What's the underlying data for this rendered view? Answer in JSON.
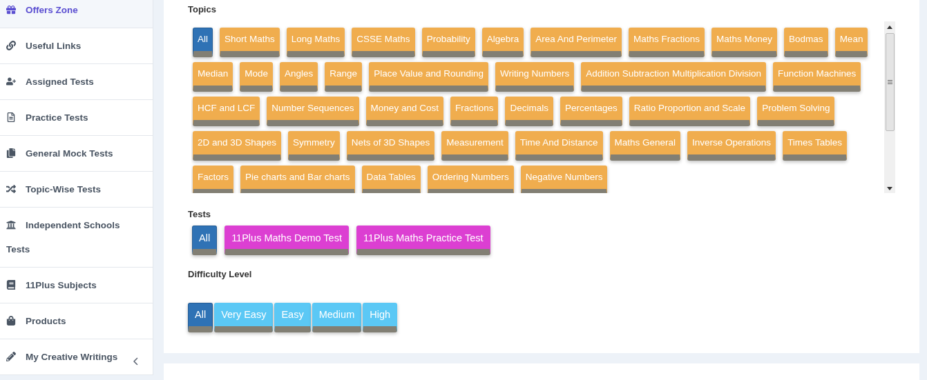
{
  "sidebar": {
    "items": [
      {
        "label": "Offers Zone",
        "selected": true,
        "has_submenu": false
      },
      {
        "label": "Useful Links",
        "selected": false,
        "has_submenu": false
      },
      {
        "label": "Assigned Tests",
        "selected": false,
        "has_submenu": false
      },
      {
        "label": "Practice Tests",
        "selected": false,
        "has_submenu": false
      },
      {
        "label": "General Mock Tests",
        "selected": false,
        "has_submenu": false
      },
      {
        "label": "Topic-Wise Tests",
        "selected": false,
        "has_submenu": false
      },
      {
        "label": "Independent Schools Tests",
        "selected": false,
        "has_submenu": false
      },
      {
        "label": "11Plus Subjects",
        "selected": false,
        "has_submenu": false
      },
      {
        "label": "Products",
        "selected": false,
        "has_submenu": false
      },
      {
        "label": "My Creative Writings",
        "selected": false,
        "has_submenu": true
      }
    ]
  },
  "filters": [
    {
      "title": "Topics",
      "kind": "topics",
      "color": "#f0ad4e",
      "scrollable": true,
      "buttons": [
        {
          "label": "All",
          "selected": true
        },
        {
          "label": "Short Maths",
          "selected": false
        },
        {
          "label": "Long Maths",
          "selected": false
        },
        {
          "label": "CSSE Maths",
          "selected": false
        },
        {
          "label": "Probability",
          "selected": false
        },
        {
          "label": "Algebra",
          "selected": false
        },
        {
          "label": "Area And Perimeter",
          "selected": false
        },
        {
          "label": "Maths Fractions",
          "selected": false
        },
        {
          "label": "Maths Money",
          "selected": false
        },
        {
          "label": "Bodmas",
          "selected": false
        },
        {
          "label": "Mean",
          "selected": false
        },
        {
          "label": "Median",
          "selected": false
        },
        {
          "label": "Mode",
          "selected": false
        },
        {
          "label": "Angles",
          "selected": false
        },
        {
          "label": "Range",
          "selected": false
        },
        {
          "label": "Place Value and Rounding",
          "selected": false
        },
        {
          "label": "Writing Numbers",
          "selected": false
        },
        {
          "label": "Addition Subtraction Multiplication Division",
          "selected": false
        },
        {
          "label": "Function Machines",
          "selected": false
        },
        {
          "label": "HCF and LCF",
          "selected": false
        },
        {
          "label": "Number Sequences",
          "selected": false
        },
        {
          "label": "Money and Cost",
          "selected": false
        },
        {
          "label": "Fractions",
          "selected": false
        },
        {
          "label": "Decimals",
          "selected": false
        },
        {
          "label": "Percentages",
          "selected": false
        },
        {
          "label": "Ratio Proportion and Scale",
          "selected": false
        },
        {
          "label": "Problem Solving",
          "selected": false
        },
        {
          "label": "2D and 3D Shapes",
          "selected": false
        },
        {
          "label": "Symmetry",
          "selected": false
        },
        {
          "label": "Nets of 3D Shapes",
          "selected": false
        },
        {
          "label": "Measurement",
          "selected": false
        },
        {
          "label": "Time And Distance",
          "selected": false
        },
        {
          "label": "Maths General",
          "selected": false
        },
        {
          "label": "Inverse Operations",
          "selected": false
        },
        {
          "label": "Times Tables",
          "selected": false
        },
        {
          "label": "Factors",
          "selected": false
        },
        {
          "label": "Pie charts and Bar charts",
          "selected": false
        },
        {
          "label": "Data Tables",
          "selected": false
        },
        {
          "label": "Ordering Numbers",
          "selected": false
        },
        {
          "label": "Negative Numbers",
          "selected": false
        }
      ]
    },
    {
      "title": "Tests",
      "kind": "tests",
      "color": "#dc3fd2",
      "scrollable": false,
      "buttons": [
        {
          "label": "All",
          "selected": true
        },
        {
          "label": "11Plus Maths Demo Test",
          "selected": false
        },
        {
          "label": "11Plus Maths Practice Test",
          "selected": false
        }
      ]
    },
    {
      "title": "Difficulty Level",
      "kind": "difficulty",
      "color": "#5bc8f5",
      "scrollable": false,
      "buttons": [
        {
          "label": "All",
          "selected": true
        },
        {
          "label": "Very Easy",
          "selected": false
        },
        {
          "label": "Easy",
          "selected": false
        },
        {
          "label": "Medium",
          "selected": false
        },
        {
          "label": "High",
          "selected": false
        }
      ]
    }
  ]
}
